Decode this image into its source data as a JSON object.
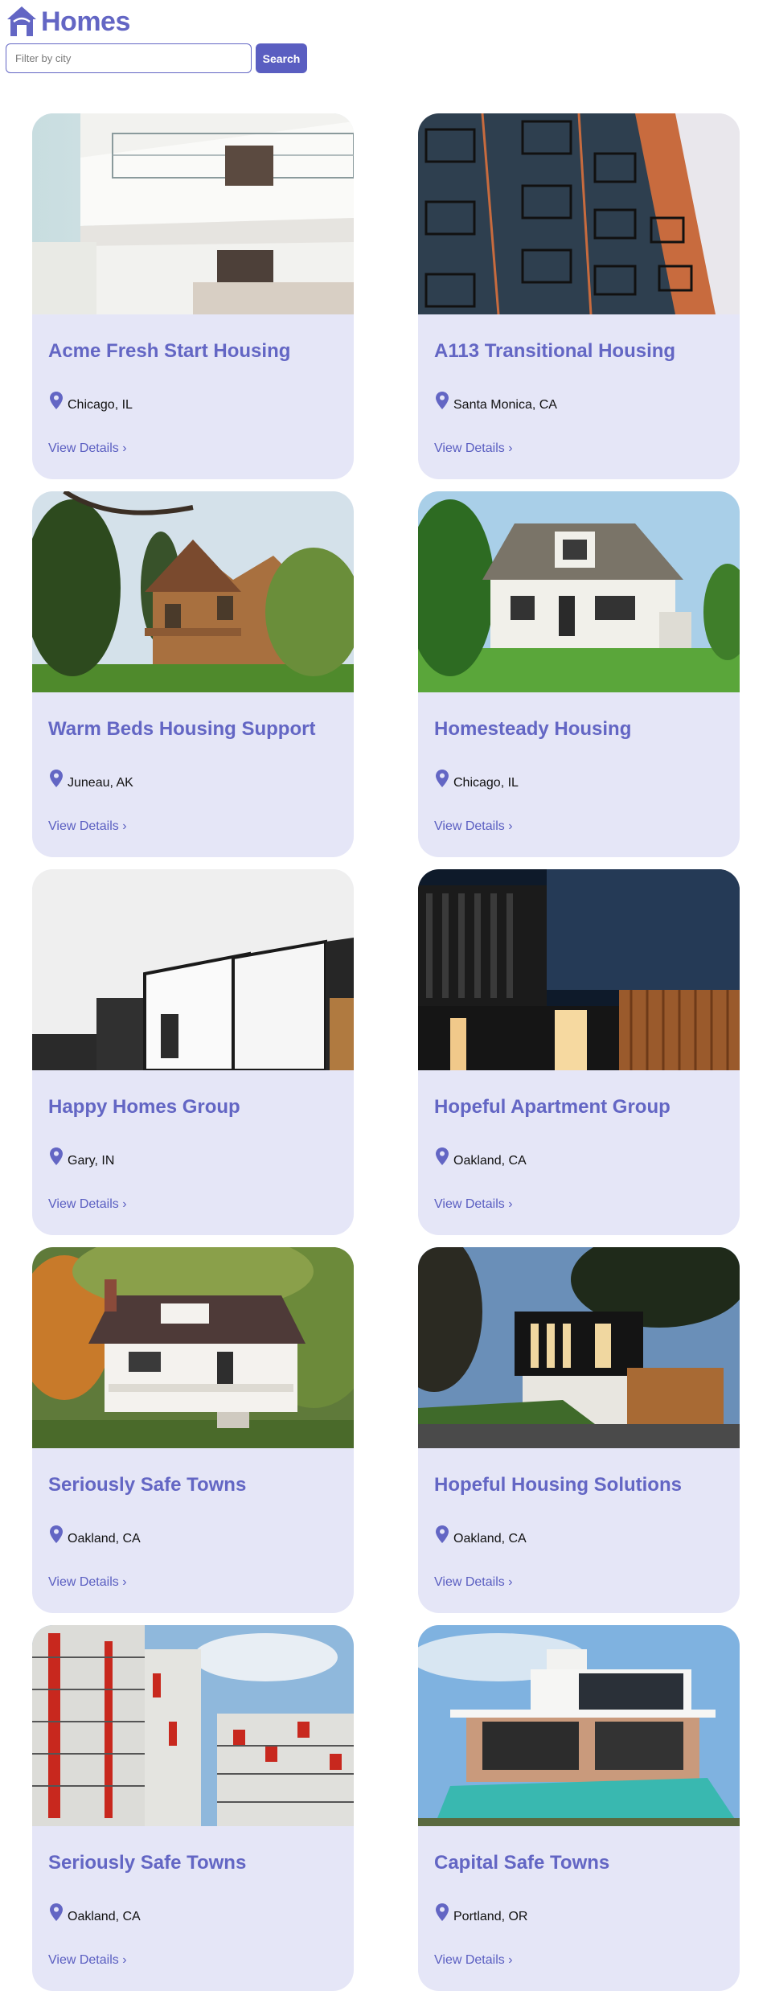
{
  "header": {
    "logo_icon": "house-icon",
    "title": "Homes"
  },
  "search": {
    "placeholder": "Filter by city",
    "value": "",
    "button_label": "Search"
  },
  "theme": {
    "accent": "#6366c4",
    "card_background": "#e5e6f7"
  },
  "listings": [
    {
      "name": "Acme Fresh Start Housing",
      "location": "Chicago, IL",
      "link": "View Details ›"
    },
    {
      "name": "A113 Transitional Housing",
      "location": "Santa Monica, CA",
      "link": "View Details ›"
    },
    {
      "name": "Warm Beds Housing Support",
      "location": "Juneau, AK",
      "link": "View Details ›"
    },
    {
      "name": "Homesteady Housing",
      "location": "Chicago, IL",
      "link": "View Details ›"
    },
    {
      "name": "Happy Homes Group",
      "location": "Gary, IN",
      "link": "View Details ›"
    },
    {
      "name": "Hopeful Apartment Group",
      "location": "Oakland, CA",
      "link": "View Details ›"
    },
    {
      "name": "Seriously Safe Towns",
      "location": "Oakland, CA",
      "link": "View Details ›"
    },
    {
      "name": "Hopeful Housing Solutions",
      "location": "Oakland, CA",
      "link": "View Details ›"
    },
    {
      "name": "Seriously Safe Towns",
      "location": "Oakland, CA",
      "link": "View Details ›"
    },
    {
      "name": "Capital Safe Towns",
      "location": "Portland, OR",
      "link": "View Details ›"
    }
  ]
}
